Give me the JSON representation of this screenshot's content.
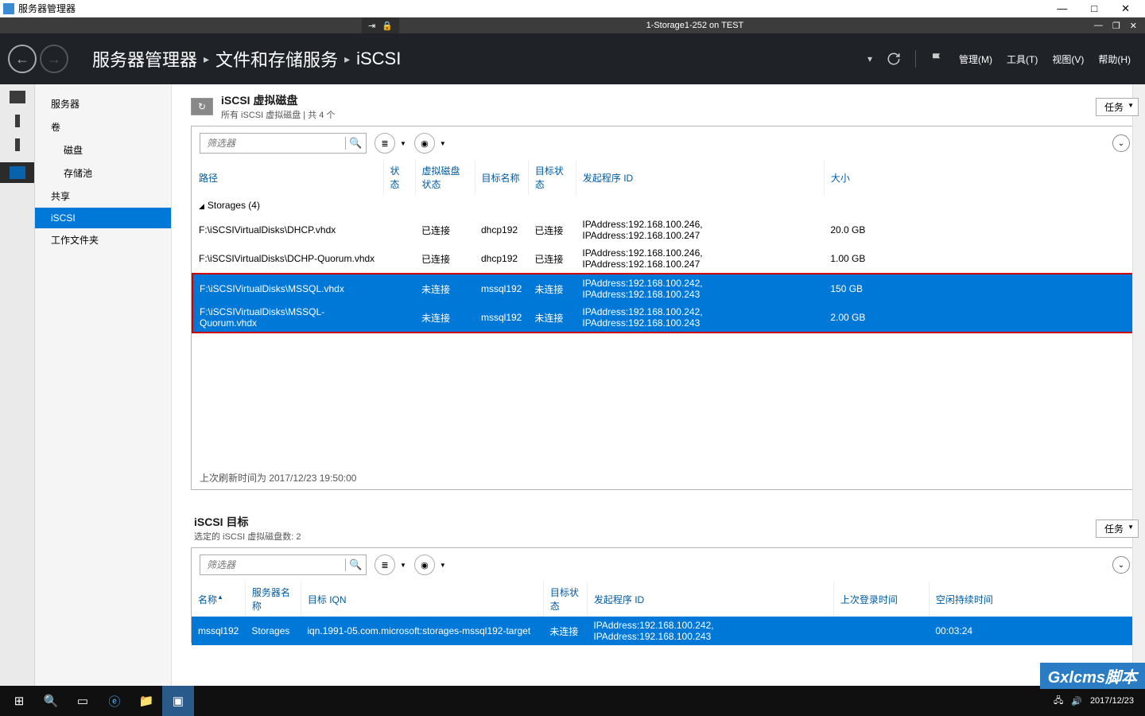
{
  "outer_window": {
    "title": "服务器管理器",
    "controls": {
      "min": "—",
      "max": "□",
      "close": "✕"
    }
  },
  "inner_window": {
    "title": "1-Storage1-252 on TEST",
    "pin_icons": [
      "⇥",
      "🔒"
    ],
    "controls": {
      "min": "—",
      "max": "❐",
      "close": "✕"
    }
  },
  "breadcrumb": {
    "root": "服务器管理器",
    "mid": "文件和存储服务",
    "leaf": "iSCSI",
    "sep": "▸"
  },
  "menu": {
    "manage": "管理(M)",
    "tools": "工具(T)",
    "view": "视图(V)",
    "help": "帮助(H)"
  },
  "nav": {
    "servers": "服务器",
    "volumes": "卷",
    "disks": "磁盘",
    "pools": "存储池",
    "shares": "共享",
    "iscsi": "iSCSI",
    "workfolders": "工作文件夹"
  },
  "section_disks": {
    "title": "iSCSI 虚拟磁盘",
    "subtitle": "所有 iSCSI 虚拟磁盘 | 共 4 个",
    "tasks": "任务",
    "filter_placeholder": "筛选器",
    "cols": {
      "path": "路径",
      "status": "状态",
      "vdisk_status": "虚拟磁盘状态",
      "target_name": "目标名称",
      "target_status": "目标状态",
      "initiator": "发起程序 ID",
      "size": "大小"
    },
    "group": "Storages (4)",
    "rows": [
      {
        "path": "F:\\iSCSIVirtualDisks\\DHCP.vhdx",
        "status": "",
        "vds": "已连接",
        "tname": "dhcp192",
        "tstatus": "已连接",
        "init": "IPAddress:192.168.100.246, IPAddress:192.168.100.247",
        "size": "20.0 GB",
        "sel": false
      },
      {
        "path": "F:\\iSCSIVirtualDisks\\DCHP-Quorum.vhdx",
        "status": "",
        "vds": "已连接",
        "tname": "dhcp192",
        "tstatus": "已连接",
        "init": "IPAddress:192.168.100.246, IPAddress:192.168.100.247",
        "size": "1.00 GB",
        "sel": false
      },
      {
        "path": "F:\\iSCSIVirtualDisks\\MSSQL.vhdx",
        "status": "",
        "vds": "未连接",
        "tname": "mssql192",
        "tstatus": "未连接",
        "init": "IPAddress:192.168.100.242, IPAddress:192.168.100.243",
        "size": "150 GB",
        "sel": true
      },
      {
        "path": "F:\\iSCSIVirtualDisks\\MSSQL-Quorum.vhdx",
        "status": "",
        "vds": "未连接",
        "tname": "mssql192",
        "tstatus": "未连接",
        "init": "IPAddress:192.168.100.242, IPAddress:192.168.100.243",
        "size": "2.00 GB",
        "sel": true
      }
    ],
    "status_line": "上次刷新时间为 2017/12/23 19:50:00"
  },
  "section_targets": {
    "title": "iSCSI 目标",
    "subtitle": "选定的 iSCSI 虚拟磁盘数: 2",
    "tasks": "任务",
    "filter_placeholder": "筛选器",
    "cols": {
      "name": "名称",
      "server": "服务器名称",
      "iqn": "目标 IQN",
      "tstatus": "目标状态",
      "initiator": "发起程序 ID",
      "last_login": "上次登录时间",
      "idle": "空闲持续时间"
    },
    "rows": [
      {
        "name": "mssql192",
        "server": "Storages",
        "iqn": "iqn.1991-05.com.microsoft:storages-mssql192-target",
        "tstatus": "未连接",
        "init": "IPAddress:192.168.100.242, IPAddress:192.168.100.243",
        "last_login": "",
        "idle": "00:03:24"
      }
    ]
  },
  "taskbar": {
    "date": "2017/12/23"
  },
  "watermark": "Gxlcms脚本"
}
